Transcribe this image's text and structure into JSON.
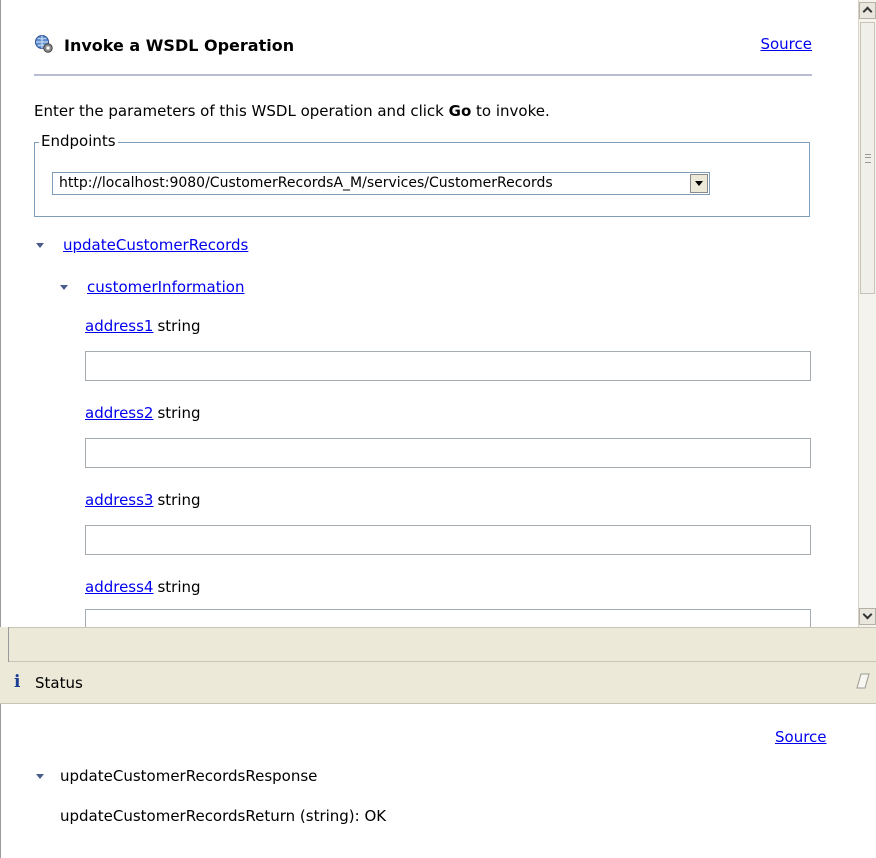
{
  "invoke": {
    "title": "Invoke a WSDL Operation",
    "icon": "globe-gear-icon",
    "source_label": "Source",
    "instructions_pre": "Enter the parameters of this WSDL operation and click ",
    "instructions_bold": "Go",
    "instructions_post": " to invoke.",
    "endpoints_legend": "Endpoints",
    "endpoint_selected": "http://localhost:9080/CustomerRecordsA_M/services/CustomerRecords",
    "operation": "updateCustomerRecords",
    "parameter": "customerInformation",
    "fields": [
      {
        "name": "address1",
        "type": "string",
        "value": ""
      },
      {
        "name": "address2",
        "type": "string",
        "value": ""
      },
      {
        "name": "address3",
        "type": "string",
        "value": ""
      },
      {
        "name": "address4",
        "type": "string",
        "value": ""
      }
    ]
  },
  "status": {
    "icon": "info-icon",
    "icon_glyph": "i",
    "title": "Status",
    "clear_icon": "eraser-icon",
    "source_label": "Source",
    "response_name": "updateCustomerRecordsResponse",
    "return_line": "updateCustomerRecordsReturn (string):  OK"
  },
  "colors": {
    "link": "#0000ee",
    "toolbar_bg": "#ece9d8",
    "field_border": "#a5acb2",
    "fieldset_border": "#7f9db9"
  }
}
